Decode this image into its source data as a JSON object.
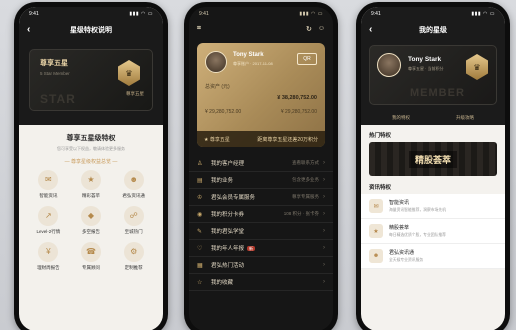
{
  "phone1": {
    "status_time": "9:41",
    "title": "星级特权说明",
    "card_level": "尊享五星",
    "card_sub": "5 Star Member",
    "card_watermark": "STAR",
    "badge_caption": "尊享五星",
    "privilege_title": "尊享五星级特权",
    "privilege_sub": "您可享受以下权益，敬请体验更多服务",
    "section_label": "— 尊享星级权益总览 —",
    "grid": [
      {
        "icon": "gift-icon",
        "glyph": "✉",
        "label": "智能资讯"
      },
      {
        "icon": "star-icon",
        "glyph": "★",
        "label": "精彩荟萃"
      },
      {
        "icon": "chat-icon",
        "glyph": "☻",
        "label": "君弘资讯通"
      },
      {
        "icon": "chart-icon",
        "glyph": "↗",
        "label": "Level-2行情"
      },
      {
        "icon": "shield-icon",
        "glyph": "◆",
        "label": "多空报告"
      },
      {
        "icon": "analysis-icon",
        "glyph": "☍",
        "label": "至城热门"
      },
      {
        "icon": "finance-icon",
        "glyph": "¥",
        "label": "理财周报告"
      },
      {
        "icon": "service-icon",
        "glyph": "☎",
        "label": "专属顾问"
      },
      {
        "icon": "custom-icon",
        "glyph": "⚙",
        "label": "定制推荐"
      }
    ]
  },
  "phone2": {
    "status_time": "9:41",
    "user_name": "Tony Stark",
    "user_sub": "尊享账户 · 2017-11-08",
    "qr_label": "QR",
    "asset_label": "总资产 (元)",
    "asset_value": "¥ 38,280,752.00",
    "sub_asset_left": "¥ 29,280,752.00",
    "sub_asset_right": "¥ 29,280,752.00",
    "level_label": "尊享五星",
    "level_hint": "距离尊享五星还差20万积分",
    "menu": [
      {
        "icon": "manager-icon",
        "glyph": "♙",
        "label": "我的客户经理",
        "right": "查看联系方式",
        "tag": ""
      },
      {
        "icon": "business-icon",
        "glyph": "▤",
        "label": "我的业务",
        "right": "包含更多业务",
        "tag": ""
      },
      {
        "icon": "vip-icon",
        "glyph": "♔",
        "label": "君弘会员专属服务",
        "right": "尊享专属服务",
        "tag": ""
      },
      {
        "icon": "points-icon",
        "glyph": "◉",
        "label": "我的积分卡券",
        "right": "108 积分 · 张卡券",
        "tag": ""
      },
      {
        "icon": "school-icon",
        "glyph": "✎",
        "label": "我的君弘学堂",
        "right": "",
        "tag": ""
      },
      {
        "icon": "report-icon",
        "glyph": "♡",
        "label": "我的年人年报",
        "right": "",
        "tag": "新"
      },
      {
        "icon": "activity-icon",
        "glyph": "▦",
        "label": "君弘热门活动",
        "right": "",
        "tag": ""
      },
      {
        "icon": "favorite-icon",
        "glyph": "☆",
        "label": "我的收藏",
        "right": "",
        "tag": ""
      }
    ]
  },
  "phone3": {
    "status_time": "9:41",
    "title": "我的星级",
    "user_name": "Tony Stark",
    "user_sub": "尊享五星 · 当前积分",
    "card_watermark": "MEMBER",
    "tab_left": "我的特权",
    "tab_right": "升级攻略",
    "hot_label": "热门特权",
    "banner_text": "精股荟萃",
    "info_label": "资讯特权",
    "rows": [
      {
        "icon": "info-icon",
        "glyph": "✉",
        "title": "智能资讯",
        "desc": "海量资讯智能推荐，洞察市场先机",
        "tag": "",
        "tag_class": ""
      },
      {
        "icon": "stock-icon",
        "glyph": "★",
        "title": "精股荟萃",
        "desc": "每日精选优质个股，专业团队推荐",
        "tag": "",
        "tag_class": ""
      },
      {
        "icon": "news-icon",
        "glyph": "☻",
        "title": "君弘资讯通",
        "desc": "全天候专业资讯服务",
        "tag": "",
        "tag_class": ""
      }
    ]
  },
  "colors": {
    "gold": "#c9a96b",
    "dark": "#161616",
    "light_bg": "#f3f1ec"
  }
}
